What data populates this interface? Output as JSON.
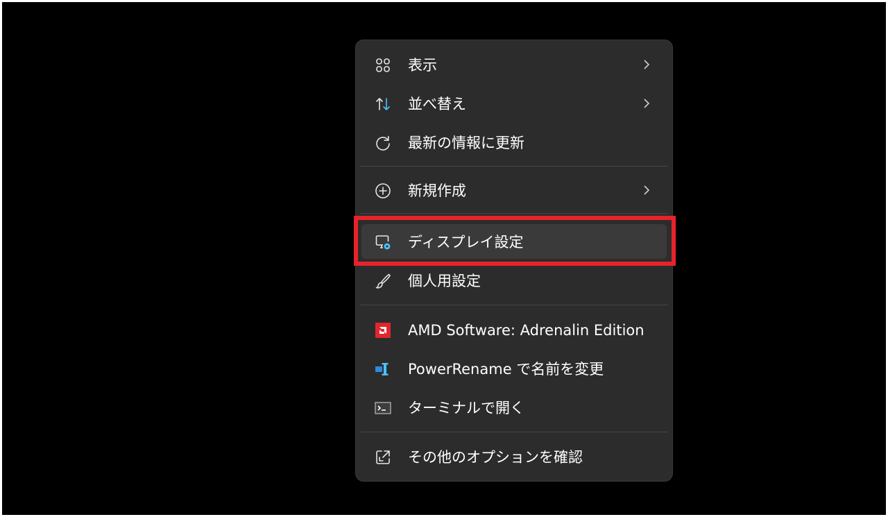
{
  "context_menu": {
    "items": [
      {
        "label": "表示",
        "icon": "grid-view-icon",
        "has_submenu": true
      },
      {
        "label": "並べ替え",
        "icon": "sort-arrows-icon",
        "has_submenu": true
      },
      {
        "label": "最新の情報に更新",
        "icon": "refresh-icon",
        "has_submenu": false
      },
      {
        "label": "新規作成",
        "icon": "plus-circle-icon",
        "has_submenu": true
      },
      {
        "label": "ディスプレイ設定",
        "icon": "display-settings-icon",
        "has_submenu": false
      },
      {
        "label": "個人用設定",
        "icon": "paintbrush-icon",
        "has_submenu": false
      },
      {
        "label": "AMD Software: Adrenalin Edition",
        "icon": "amd-logo-icon",
        "has_submenu": false
      },
      {
        "label": "PowerRename で名前を変更",
        "icon": "powerrename-icon",
        "has_submenu": false
      },
      {
        "label": "ターミナルで開く",
        "icon": "terminal-icon",
        "has_submenu": false
      },
      {
        "label": "その他のオプションを確認",
        "icon": "open-external-icon",
        "has_submenu": false
      }
    ],
    "highlighted_item": "ディスプレイ設定"
  },
  "colors": {
    "menu_background": "#2c2c2c",
    "hover_background": "#3a3a3a",
    "highlight_frame": "#e8222a",
    "amd_red": "#e0262e",
    "accent_blue": "#4cc2ff"
  }
}
